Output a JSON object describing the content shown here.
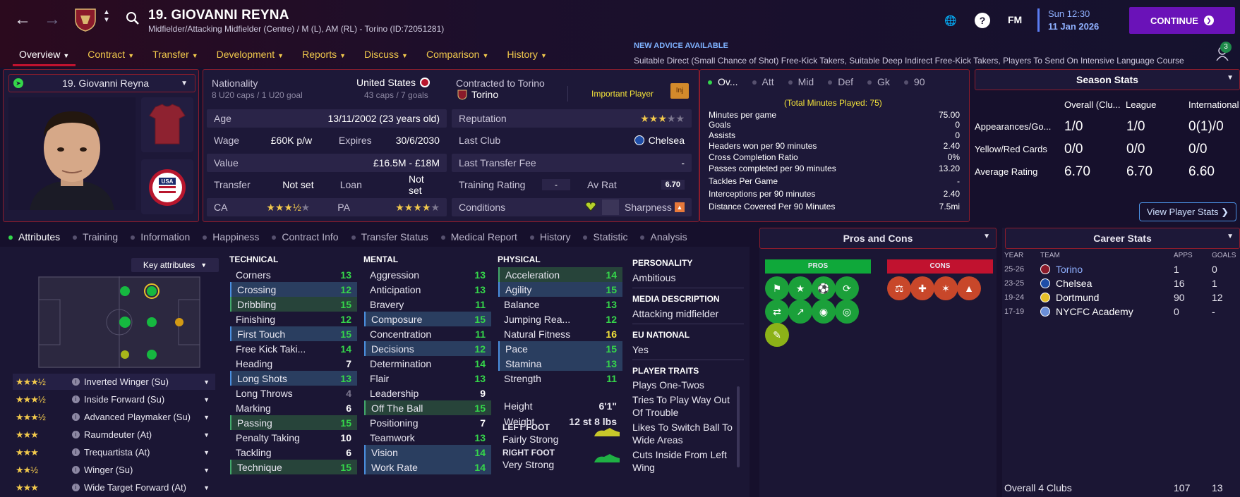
{
  "header": {
    "player_title": "19. GIOVANNI REYNA",
    "player_subtitle": "Midfielder/Attacking Midfielder (Centre) / M (L), AM (RL) - Torino (ID:72051281)",
    "tabs": [
      {
        "label": "Overview",
        "active": true
      },
      {
        "label": "Contract"
      },
      {
        "label": "Transfer"
      },
      {
        "label": "Development"
      },
      {
        "label": "Reports"
      },
      {
        "label": "Discuss"
      },
      {
        "label": "Comparison"
      },
      {
        "label": "History"
      }
    ],
    "advice_head": "NEW ADVICE AVAILABLE",
    "advice_text": "Suitable Direct (Small Chance of Shot) Free-Kick Takers, Suitable Deep Indirect Free-Kick Takers, Players To Send On Intensive Language Course",
    "fm_label": "FM",
    "date_time": "Sun 12:30",
    "date_day": "11 Jan 2026",
    "continue_label": "CONTINUE",
    "notification_count": "3"
  },
  "card": {
    "selector_label": "19. Giovanni Reyna",
    "nationality_label": "Nationality",
    "nationality_value": "United States",
    "u20_caps": "8 U20 caps / 1 U20 goal",
    "caps": "43 caps / 7 goals",
    "contracted_label": "Contracted to Torino",
    "club": "Torino",
    "squad_status": "Important Player",
    "inj": "Inj",
    "age_label": "Age",
    "age_value": "13/11/2002 (23 years old)",
    "reputation_label": "Reputation",
    "wage_label": "Wage",
    "wage_value": "£60K p/w",
    "expires_label": "Expires",
    "expires_value": "30/6/2030",
    "last_club_label": "Last Club",
    "last_club_value": "Chelsea",
    "value_label": "Value",
    "value_value": "£16.5M - £18M",
    "last_fee_label": "Last Transfer Fee",
    "last_fee_value": "-",
    "transfer_label": "Transfer",
    "transfer_value": "Not set",
    "loan_label": "Loan",
    "loan_value": "Not set",
    "training_label": "Training Rating",
    "training_value": "-",
    "avrat_label": "Av Rat",
    "avrat_value": "6.70",
    "ca_label": "CA",
    "pa_label": "PA",
    "conditions_label": "Conditions",
    "sharpness_label": "Sharpness"
  },
  "stats": {
    "tabs": [
      "Ov...",
      "Att",
      "Mid",
      "Def",
      "Gk",
      "90"
    ],
    "total_minutes": "(Total Minutes Played: 75)",
    "lines": [
      [
        "Minutes per game",
        "75.00"
      ],
      [
        "Goals",
        "0"
      ],
      [
        "Assists",
        "0"
      ],
      [
        "Headers won per 90 minutes",
        "2.40"
      ],
      [
        "Cross Completion Ratio",
        "0%"
      ],
      [
        "Passes completed per 90 minutes",
        "13.20"
      ],
      [
        "Tackles Per Game",
        "-"
      ],
      [
        "Interceptions per 90 minutes",
        "2.40"
      ],
      [
        "Distance Covered Per 90 Minutes",
        "7.5mi"
      ]
    ]
  },
  "season": {
    "title": "Season Stats",
    "cols": [
      "Overall (Clu...",
      "League",
      "International"
    ],
    "rows": [
      {
        "label": "Appearances/Go...",
        "v": [
          "1/0",
          "1/0",
          "0(1)/0"
        ]
      },
      {
        "label": "Yellow/Red Cards",
        "v": [
          "0/0",
          "0/0",
          "0/0"
        ]
      },
      {
        "label": "Average Rating",
        "v": [
          "6.70",
          "6.70",
          "6.60"
        ]
      }
    ],
    "view_btn": "View Player Stats"
  },
  "lower_tabs": [
    "Attributes",
    "Training",
    "Information",
    "Happiness",
    "Contract Info",
    "Transfer Status",
    "Medical Report",
    "History",
    "Statistic",
    "Analysis"
  ],
  "key_attributes": "Key attributes",
  "technical": {
    "title": "TECHNICAL",
    "items": [
      {
        "n": "Corners",
        "v": "13",
        "c": "g",
        "h": ""
      },
      {
        "n": "Crossing",
        "v": "12",
        "c": "g",
        "h": "key"
      },
      {
        "n": "Dribbling",
        "v": "15",
        "c": "g",
        "h": "pos"
      },
      {
        "n": "Finishing",
        "v": "12",
        "c": "g",
        "h": ""
      },
      {
        "n": "First Touch",
        "v": "15",
        "c": "g",
        "h": "key"
      },
      {
        "n": "Free Kick Taki...",
        "v": "14",
        "c": "g",
        "h": ""
      },
      {
        "n": "Heading",
        "v": "7",
        "c": "w",
        "h": ""
      },
      {
        "n": "Long Shots",
        "v": "13",
        "c": "g",
        "h": "key"
      },
      {
        "n": "Long Throws",
        "v": "4",
        "c": "gr",
        "h": ""
      },
      {
        "n": "Marking",
        "v": "6",
        "c": "w",
        "h": ""
      },
      {
        "n": "Passing",
        "v": "15",
        "c": "g",
        "h": "pos"
      },
      {
        "n": "Penalty Taking",
        "v": "10",
        "c": "w",
        "h": ""
      },
      {
        "n": "Tackling",
        "v": "6",
        "c": "w",
        "h": ""
      },
      {
        "n": "Technique",
        "v": "15",
        "c": "g",
        "h": "pos"
      }
    ]
  },
  "mental": {
    "title": "MENTAL",
    "items": [
      {
        "n": "Aggression",
        "v": "13",
        "c": "g",
        "h": ""
      },
      {
        "n": "Anticipation",
        "v": "13",
        "c": "g",
        "h": ""
      },
      {
        "n": "Bravery",
        "v": "11",
        "c": "g",
        "h": ""
      },
      {
        "n": "Composure",
        "v": "15",
        "c": "g",
        "h": "key"
      },
      {
        "n": "Concentration",
        "v": "11",
        "c": "g",
        "h": ""
      },
      {
        "n": "Decisions",
        "v": "12",
        "c": "g",
        "h": "key"
      },
      {
        "n": "Determination",
        "v": "14",
        "c": "g",
        "h": ""
      },
      {
        "n": "Flair",
        "v": "13",
        "c": "g",
        "h": ""
      },
      {
        "n": "Leadership",
        "v": "9",
        "c": "w",
        "h": ""
      },
      {
        "n": "Off The Ball",
        "v": "15",
        "c": "g",
        "h": "pos"
      },
      {
        "n": "Positioning",
        "v": "7",
        "c": "w",
        "h": ""
      },
      {
        "n": "Teamwork",
        "v": "13",
        "c": "g",
        "h": ""
      },
      {
        "n": "Vision",
        "v": "14",
        "c": "g",
        "h": "key"
      },
      {
        "n": "Work Rate",
        "v": "14",
        "c": "g",
        "h": "key"
      }
    ]
  },
  "physical": {
    "title": "PHYSICAL",
    "items": [
      {
        "n": "Acceleration",
        "v": "14",
        "c": "g",
        "h": "pos"
      },
      {
        "n": "Agility",
        "v": "15",
        "c": "g",
        "h": "key"
      },
      {
        "n": "Balance",
        "v": "13",
        "c": "g",
        "h": ""
      },
      {
        "n": "Jumping Rea...",
        "v": "12",
        "c": "g",
        "h": ""
      },
      {
        "n": "Natural Fitness",
        "v": "16",
        "c": "y",
        "h": ""
      },
      {
        "n": "Pace",
        "v": "15",
        "c": "g",
        "h": "key"
      },
      {
        "n": "Stamina",
        "v": "13",
        "c": "g",
        "h": "key"
      },
      {
        "n": "Strength",
        "v": "11",
        "c": "g",
        "h": ""
      }
    ],
    "height_label": "Height",
    "height_value": "6'1\"",
    "weight_label": "Weight",
    "weight_value": "12 st 8 lbs",
    "left_foot_label": "LEFT FOOT",
    "left_foot_value": "Fairly Strong",
    "right_foot_label": "RIGHT FOOT",
    "right_foot_value": "Very Strong"
  },
  "personality": {
    "title": "PERSONALITY",
    "value": "Ambitious",
    "media_title": "MEDIA DESCRIPTION",
    "media_value": "Attacking midfielder",
    "eu_title": "EU NATIONAL",
    "eu_value": "Yes",
    "traits_title": "PLAYER TRAITS",
    "traits": [
      "Plays One-Twos",
      "Tries To Play Way Out Of Trouble",
      "Likes To Switch Ball To Wide Areas",
      "Cuts Inside From Left Wing"
    ]
  },
  "roles": [
    {
      "stars": "★★★½",
      "label": "Inverted Winger (Su)",
      "active": true
    },
    {
      "stars": "★★★½",
      "label": "Inside Forward (Su)"
    },
    {
      "stars": "★★★½",
      "label": "Advanced Playmaker (Su)"
    },
    {
      "stars": "★★★",
      "label": "Raumdeuter (At)"
    },
    {
      "stars": "★★★",
      "label": "Trequartista (At)"
    },
    {
      "stars": "★★½",
      "label": "Winger (Su)"
    },
    {
      "stars": "★★★",
      "label": "Wide Target Forward (At)"
    }
  ],
  "pros_cons": {
    "title": "Pros and Cons",
    "pros_label": "PROS",
    "cons_label": "CONS"
  },
  "career": {
    "title": "Career Stats",
    "cols": [
      "YEAR",
      "TEAM",
      "APPS",
      "GOALS"
    ],
    "rows": [
      {
        "year": "25-26",
        "team": "Torino",
        "apps": "1",
        "goals": "0"
      },
      {
        "year": "23-25",
        "team": "Chelsea",
        "apps": "16",
        "goals": "1"
      },
      {
        "year": "19-24",
        "team": "Dortmund",
        "apps": "90",
        "goals": "12"
      },
      {
        "year": "17-19",
        "team": "NYCFC Academy",
        "apps": "0",
        "goals": "-"
      }
    ],
    "total_label": "Overall 4 Clubs",
    "total_apps": "107",
    "total_goals": "13"
  },
  "colors": {
    "accent": "#6a12b8",
    "tab_gold": "#f2c94c",
    "border_red": "#8b1c2c",
    "good_green": "#35d64a"
  }
}
